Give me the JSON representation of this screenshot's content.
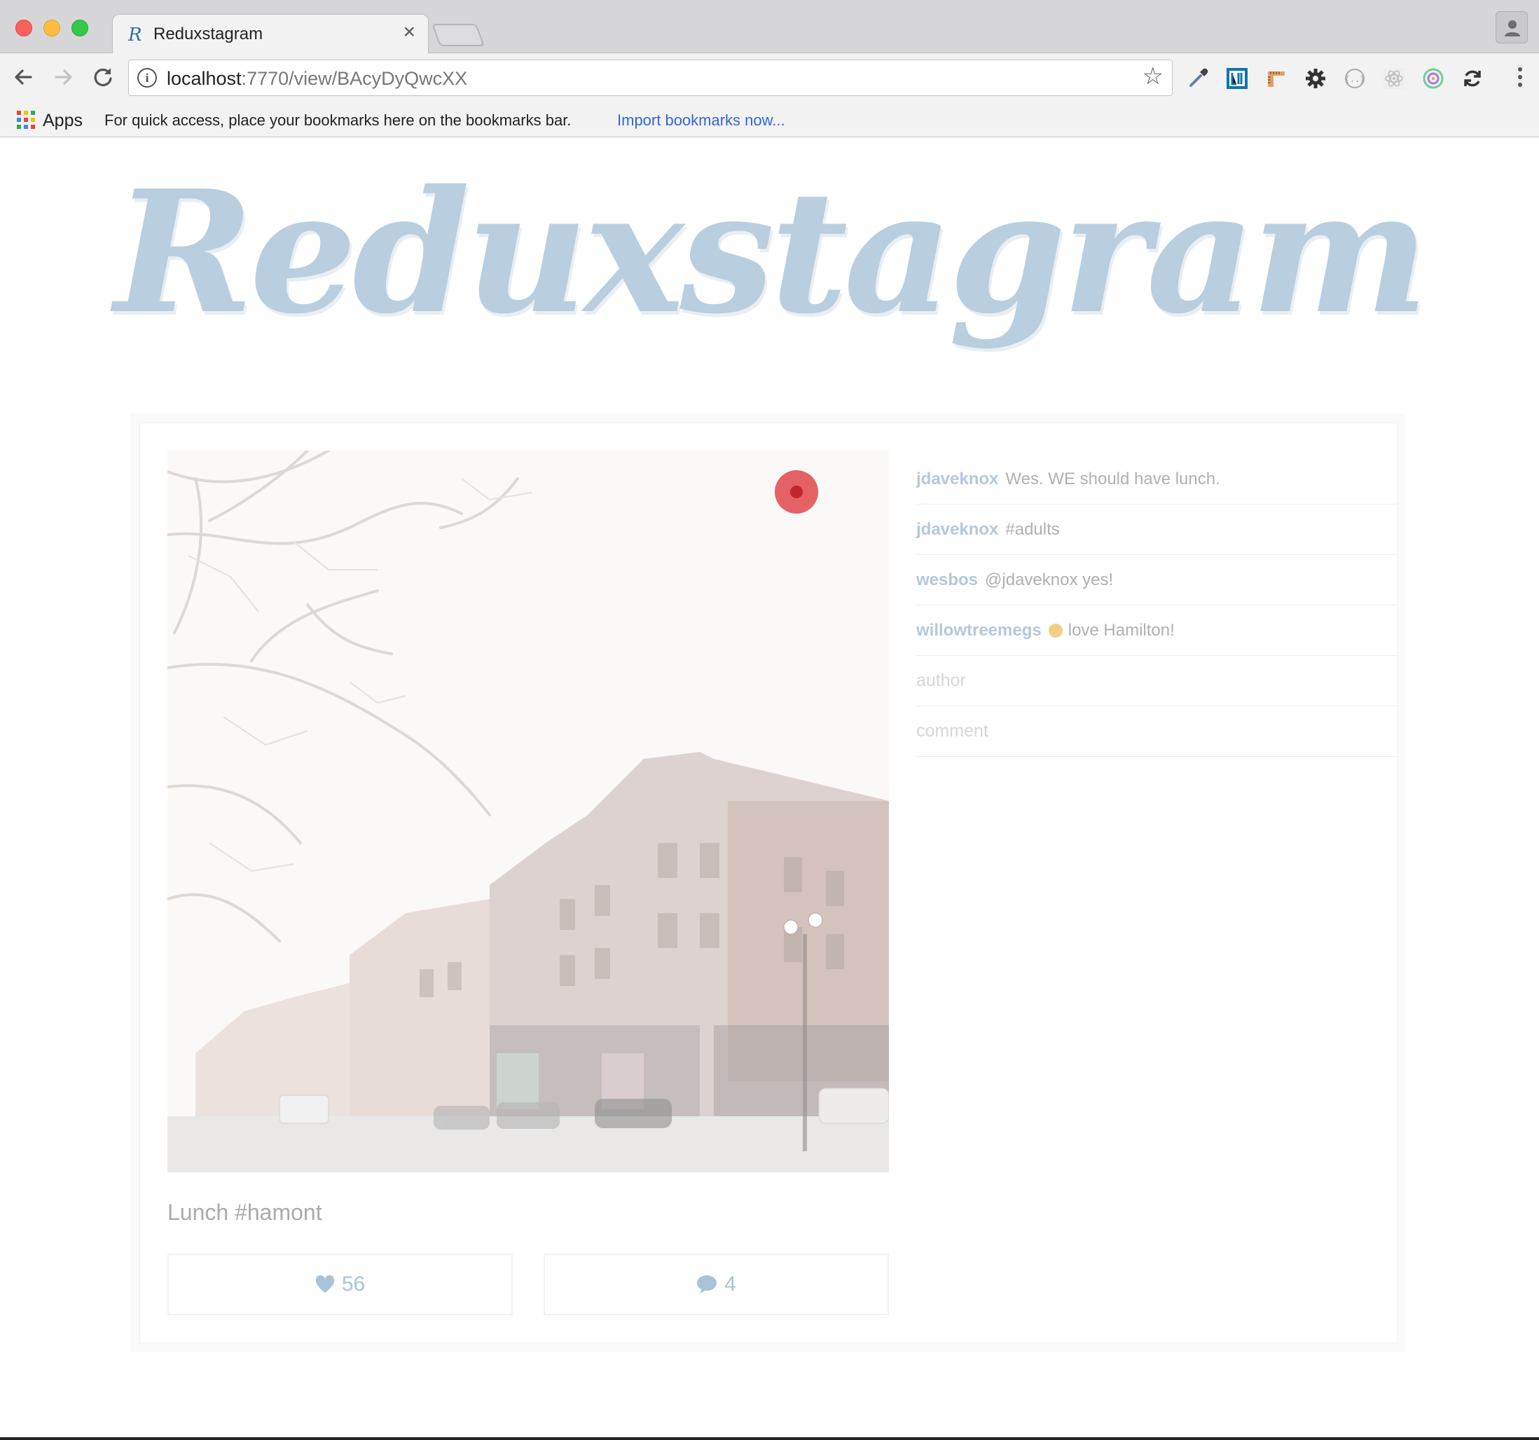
{
  "browser": {
    "tab_title": "Reduxstagram",
    "tab_favicon": "R",
    "tab_close": "×",
    "url_host": "localhost",
    "url_path": ":7770/view/BAcyDyQwcXX",
    "bookmarks_bar": {
      "apps_label": "Apps",
      "hint": "For quick access, place your bookmarks here on the bookmarks bar.",
      "import_link": "Import bookmarks now..."
    },
    "extensions": [
      "eyedropper-icon",
      "linkedin-icon",
      "ruler-icon",
      "gear-icon",
      "json-viewer-icon",
      "react-devtools-icon",
      "redux-devtools-icon",
      "sync-icon"
    ]
  },
  "page": {
    "logo": "Reduxstagram",
    "post": {
      "caption": "Lunch #hamont",
      "likes": "56",
      "comment_count": "4",
      "comments": [
        {
          "user": "jdaveknox",
          "text": "Wes. WE should have lunch."
        },
        {
          "user": "jdaveknox",
          "text": "#adults"
        },
        {
          "user": "wesbos",
          "text": "@jdaveknox yes!"
        },
        {
          "user": "willowtreemegs",
          "text": "love Hamilton!",
          "emoji": "smiling-face-emoji"
        }
      ],
      "form": {
        "author_placeholder": "author",
        "comment_placeholder": "comment"
      }
    }
  },
  "colors": {
    "logo": "#b9cedf",
    "accent": "#a9c3d8",
    "record_dot": "#e46265"
  }
}
